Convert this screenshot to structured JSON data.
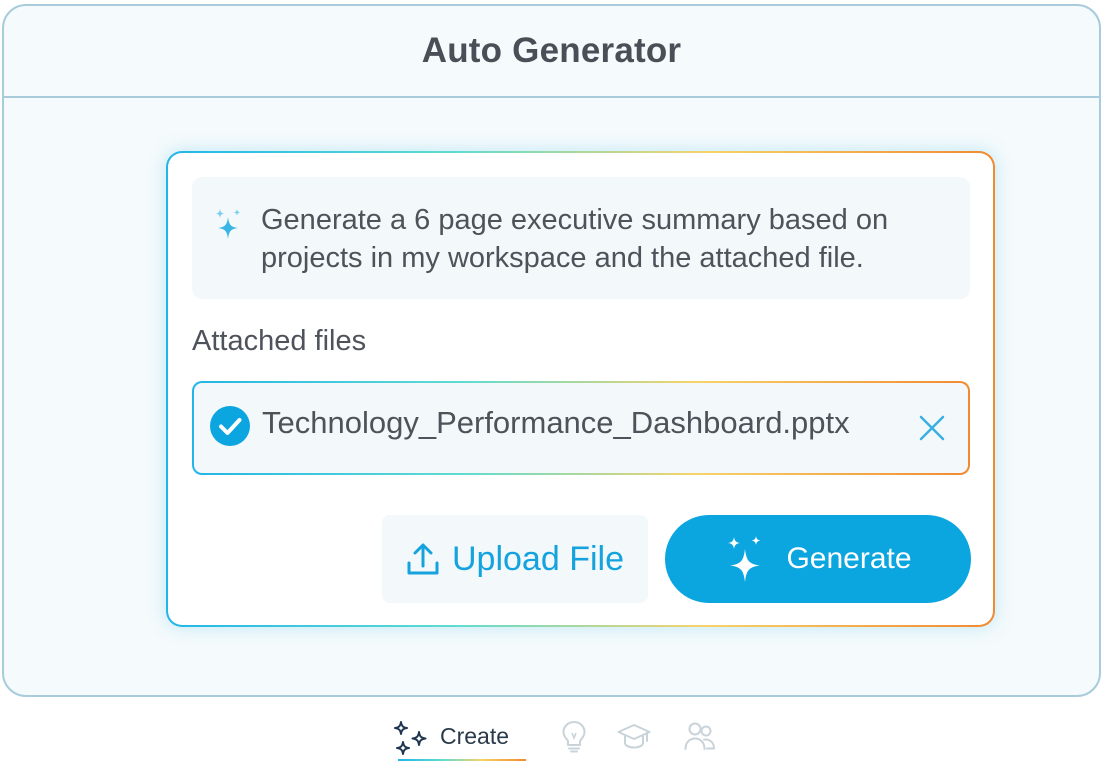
{
  "window": {
    "title": "Auto Generator"
  },
  "prompt": {
    "icon": "sparkles-icon",
    "text": "Generate a 6 page executive summary based on projects in my workspace and the attached file."
  },
  "attachments": {
    "label": "Attached files",
    "files": [
      {
        "name": "Technology_Performance_Dashboard.pptx",
        "status": "uploaded",
        "status_icon": "check-circle-icon"
      }
    ]
  },
  "actions": {
    "upload_label": "Upload File",
    "generate_label": "Generate"
  },
  "bottom_nav": {
    "active_label": "Create",
    "items": [
      {
        "icon": "sparkles-icon",
        "label": "Create",
        "active": true
      },
      {
        "icon": "lightbulb-icon",
        "active": false
      },
      {
        "icon": "graduation-cap-icon",
        "active": false
      },
      {
        "icon": "users-icon",
        "active": false
      }
    ]
  },
  "colors": {
    "accent": "#0ba5e0",
    "gradient_start": "#23b5e8",
    "gradient_end": "#f2892f",
    "window_border": "#a9ccdc",
    "window_background": "#f5fafc"
  }
}
